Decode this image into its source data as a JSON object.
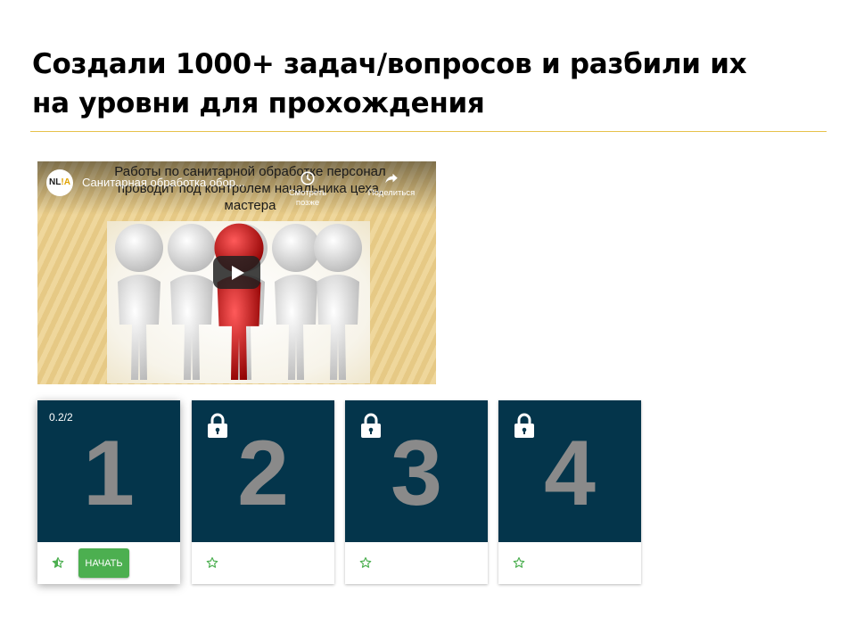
{
  "slide": {
    "title_line1": "Создали 1000+ задач/вопросов и разбили их",
    "title_line2": "на уровни для прохождения"
  },
  "video": {
    "slide_text_line1": "Работы по санитарной обработке персонал",
    "slide_text_line2": "проводит под контролем начальника цеха,",
    "slide_text_line3": "мастера",
    "channel_logo_text": "NL",
    "channel_logo_accent": "!A",
    "title": "Санитарная обработка обор...",
    "watch_later_label": "Смотреть позже",
    "share_label": "Поделиться",
    "icons": {
      "watch_later": "clock-icon",
      "share": "share-arrow-icon",
      "play": "play-icon"
    }
  },
  "levels": [
    {
      "number": "1",
      "progress": "0.2/2",
      "locked": false,
      "start_label": "НАЧАТЬ",
      "star": "star-half-icon"
    },
    {
      "number": "2",
      "locked": true,
      "star": "star-outline-icon"
    },
    {
      "number": "3",
      "locked": true,
      "star": "star-outline-icon"
    },
    {
      "number": "4",
      "locked": true,
      "star": "star-outline-icon"
    }
  ],
  "colors": {
    "card_top": "#04354b",
    "level_number": "#8a8a8a",
    "accent_green": "#4caf50",
    "divider": "#e6c24a"
  }
}
